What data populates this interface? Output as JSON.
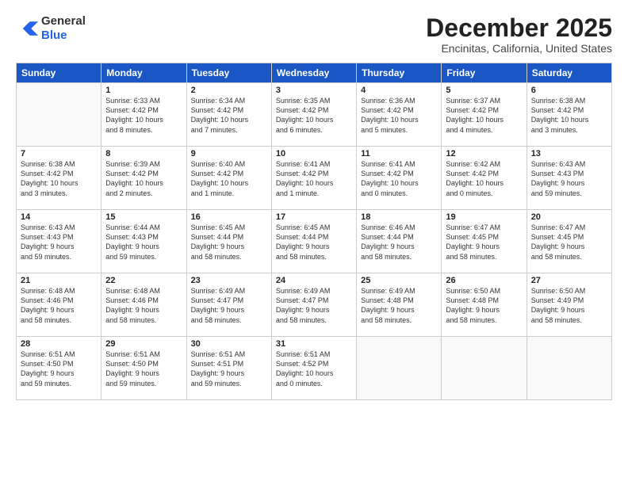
{
  "header": {
    "logo_line1": "General",
    "logo_line2": "Blue",
    "main_title": "December 2025",
    "subtitle": "Encinitas, California, United States"
  },
  "calendar": {
    "days_of_week": [
      "Sunday",
      "Monday",
      "Tuesday",
      "Wednesday",
      "Thursday",
      "Friday",
      "Saturday"
    ],
    "weeks": [
      [
        {
          "day": "",
          "info": ""
        },
        {
          "day": "1",
          "info": "Sunrise: 6:33 AM\nSunset: 4:42 PM\nDaylight: 10 hours\nand 8 minutes."
        },
        {
          "day": "2",
          "info": "Sunrise: 6:34 AM\nSunset: 4:42 PM\nDaylight: 10 hours\nand 7 minutes."
        },
        {
          "day": "3",
          "info": "Sunrise: 6:35 AM\nSunset: 4:42 PM\nDaylight: 10 hours\nand 6 minutes."
        },
        {
          "day": "4",
          "info": "Sunrise: 6:36 AM\nSunset: 4:42 PM\nDaylight: 10 hours\nand 5 minutes."
        },
        {
          "day": "5",
          "info": "Sunrise: 6:37 AM\nSunset: 4:42 PM\nDaylight: 10 hours\nand 4 minutes."
        },
        {
          "day": "6",
          "info": "Sunrise: 6:38 AM\nSunset: 4:42 PM\nDaylight: 10 hours\nand 3 minutes."
        }
      ],
      [
        {
          "day": "7",
          "info": "Sunrise: 6:38 AM\nSunset: 4:42 PM\nDaylight: 10 hours\nand 3 minutes."
        },
        {
          "day": "8",
          "info": "Sunrise: 6:39 AM\nSunset: 4:42 PM\nDaylight: 10 hours\nand 2 minutes."
        },
        {
          "day": "9",
          "info": "Sunrise: 6:40 AM\nSunset: 4:42 PM\nDaylight: 10 hours\nand 1 minute."
        },
        {
          "day": "10",
          "info": "Sunrise: 6:41 AM\nSunset: 4:42 PM\nDaylight: 10 hours\nand 1 minute."
        },
        {
          "day": "11",
          "info": "Sunrise: 6:41 AM\nSunset: 4:42 PM\nDaylight: 10 hours\nand 0 minutes."
        },
        {
          "day": "12",
          "info": "Sunrise: 6:42 AM\nSunset: 4:42 PM\nDaylight: 10 hours\nand 0 minutes."
        },
        {
          "day": "13",
          "info": "Sunrise: 6:43 AM\nSunset: 4:43 PM\nDaylight: 9 hours\nand 59 minutes."
        }
      ],
      [
        {
          "day": "14",
          "info": "Sunrise: 6:43 AM\nSunset: 4:43 PM\nDaylight: 9 hours\nand 59 minutes."
        },
        {
          "day": "15",
          "info": "Sunrise: 6:44 AM\nSunset: 4:43 PM\nDaylight: 9 hours\nand 59 minutes."
        },
        {
          "day": "16",
          "info": "Sunrise: 6:45 AM\nSunset: 4:44 PM\nDaylight: 9 hours\nand 58 minutes."
        },
        {
          "day": "17",
          "info": "Sunrise: 6:45 AM\nSunset: 4:44 PM\nDaylight: 9 hours\nand 58 minutes."
        },
        {
          "day": "18",
          "info": "Sunrise: 6:46 AM\nSunset: 4:44 PM\nDaylight: 9 hours\nand 58 minutes."
        },
        {
          "day": "19",
          "info": "Sunrise: 6:47 AM\nSunset: 4:45 PM\nDaylight: 9 hours\nand 58 minutes."
        },
        {
          "day": "20",
          "info": "Sunrise: 6:47 AM\nSunset: 4:45 PM\nDaylight: 9 hours\nand 58 minutes."
        }
      ],
      [
        {
          "day": "21",
          "info": "Sunrise: 6:48 AM\nSunset: 4:46 PM\nDaylight: 9 hours\nand 58 minutes."
        },
        {
          "day": "22",
          "info": "Sunrise: 6:48 AM\nSunset: 4:46 PM\nDaylight: 9 hours\nand 58 minutes."
        },
        {
          "day": "23",
          "info": "Sunrise: 6:49 AM\nSunset: 4:47 PM\nDaylight: 9 hours\nand 58 minutes."
        },
        {
          "day": "24",
          "info": "Sunrise: 6:49 AM\nSunset: 4:47 PM\nDaylight: 9 hours\nand 58 minutes."
        },
        {
          "day": "25",
          "info": "Sunrise: 6:49 AM\nSunset: 4:48 PM\nDaylight: 9 hours\nand 58 minutes."
        },
        {
          "day": "26",
          "info": "Sunrise: 6:50 AM\nSunset: 4:48 PM\nDaylight: 9 hours\nand 58 minutes."
        },
        {
          "day": "27",
          "info": "Sunrise: 6:50 AM\nSunset: 4:49 PM\nDaylight: 9 hours\nand 58 minutes."
        }
      ],
      [
        {
          "day": "28",
          "info": "Sunrise: 6:51 AM\nSunset: 4:50 PM\nDaylight: 9 hours\nand 59 minutes."
        },
        {
          "day": "29",
          "info": "Sunrise: 6:51 AM\nSunset: 4:50 PM\nDaylight: 9 hours\nand 59 minutes."
        },
        {
          "day": "30",
          "info": "Sunrise: 6:51 AM\nSunset: 4:51 PM\nDaylight: 9 hours\nand 59 minutes."
        },
        {
          "day": "31",
          "info": "Sunrise: 6:51 AM\nSunset: 4:52 PM\nDaylight: 10 hours\nand 0 minutes."
        },
        {
          "day": "",
          "info": ""
        },
        {
          "day": "",
          "info": ""
        },
        {
          "day": "",
          "info": ""
        }
      ]
    ]
  }
}
